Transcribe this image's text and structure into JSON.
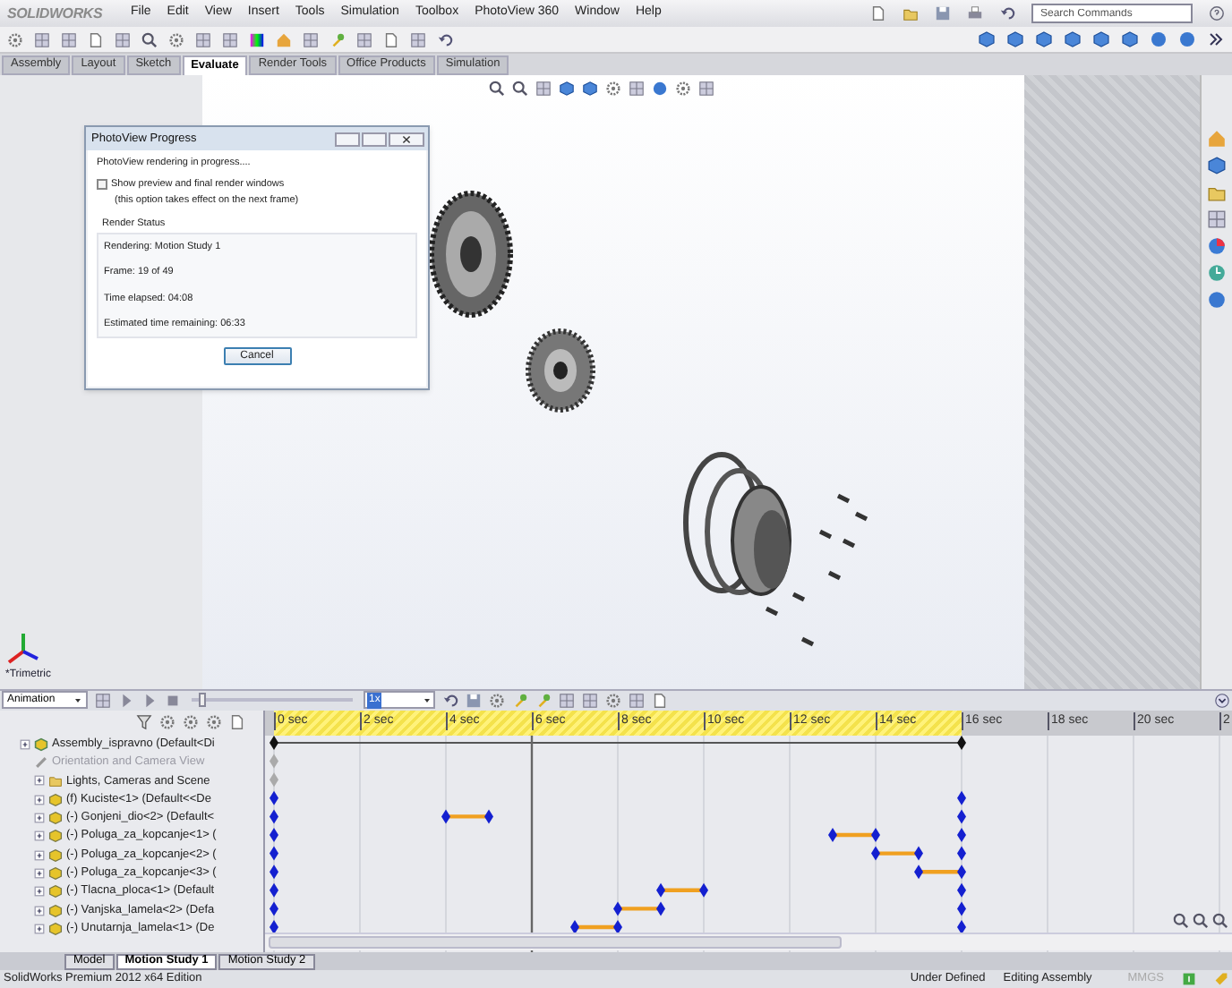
{
  "app": {
    "logo": "SOLIDWORKS",
    "menu": [
      "File",
      "Edit",
      "View",
      "Insert",
      "Tools",
      "Simulation",
      "Toolbox",
      "PhotoView 360",
      "Window",
      "Help"
    ],
    "search": {
      "placeholder": "Search Commands"
    }
  },
  "command_tabs": [
    {
      "label": "Assembly",
      "selected": false
    },
    {
      "label": "Layout",
      "selected": false
    },
    {
      "label": "Sketch",
      "selected": false
    },
    {
      "label": "Evaluate",
      "selected": true
    },
    {
      "label": "Render Tools",
      "selected": false
    },
    {
      "label": "Office Products",
      "selected": false
    },
    {
      "label": "Simulation",
      "selected": false
    }
  ],
  "viewport": {
    "view_name": "*Trimetric"
  },
  "dialog": {
    "title": "PhotoView Progress",
    "message": "PhotoView rendering in progress....",
    "checkbox": {
      "label": "Show preview and final render windows",
      "checked": false
    },
    "note": "(this option takes effect on the next frame)",
    "group": "Render Status",
    "status_lines": [
      "Rendering: Motion Study 1",
      "Frame: 19 of 49",
      "Time elapsed: 04:08",
      "Estimated time remaining: 06:33"
    ],
    "button": "Cancel"
  },
  "motion_manager": {
    "study_type": "Animation",
    "speed": "1x",
    "slider": {
      "level": 0.05
    },
    "rows": [
      {
        "label": "Assembly_ispravno  (Default<Di",
        "kind": "assembly",
        "children": [
          {
            "label": "Orientation and Camera View",
            "kind": "view"
          },
          {
            "label": "Lights, Cameras and Scene",
            "kind": "lights"
          },
          {
            "label": "(f) Kuciste<1> (Default<<De",
            "kind": "component"
          },
          {
            "label": "(-) Gonjeni_dio<2> (Default<",
            "kind": "component"
          },
          {
            "label": "(-) Poluga_za_kopcanje<1> (",
            "kind": "component"
          },
          {
            "label": "(-) Poluga_za_kopcanje<2> (",
            "kind": "component"
          },
          {
            "label": "(-) Poluga_za_kopcanje<3> (",
            "kind": "component"
          },
          {
            "label": "(-) Tlacna_ploca<1> (Default",
            "kind": "component"
          },
          {
            "label": "(-) Vanjska_lamela<2> (Defa",
            "kind": "component"
          },
          {
            "label": "(-) Unutarnja_lamela<1> (De",
            "kind": "component"
          }
        ]
      }
    ],
    "ruler": [
      "0 sec",
      "2 sec",
      "4 sec",
      "6 sec",
      "8 sec",
      "10 sec",
      "12 sec",
      "14 sec",
      "16 sec",
      "18 sec",
      "20 sec",
      "2"
    ]
  },
  "study_tabs": [
    {
      "label": "Model",
      "selected": false
    },
    {
      "label": "Motion Study 1",
      "selected": true
    },
    {
      "label": "Motion Study 2",
      "selected": false
    }
  ],
  "status_bar": {
    "edition": "SolidWorks Premium 2012 x64 Edition",
    "items": [
      "Under Defined",
      "Editing Assembly"
    ],
    "units": "MMGS"
  }
}
